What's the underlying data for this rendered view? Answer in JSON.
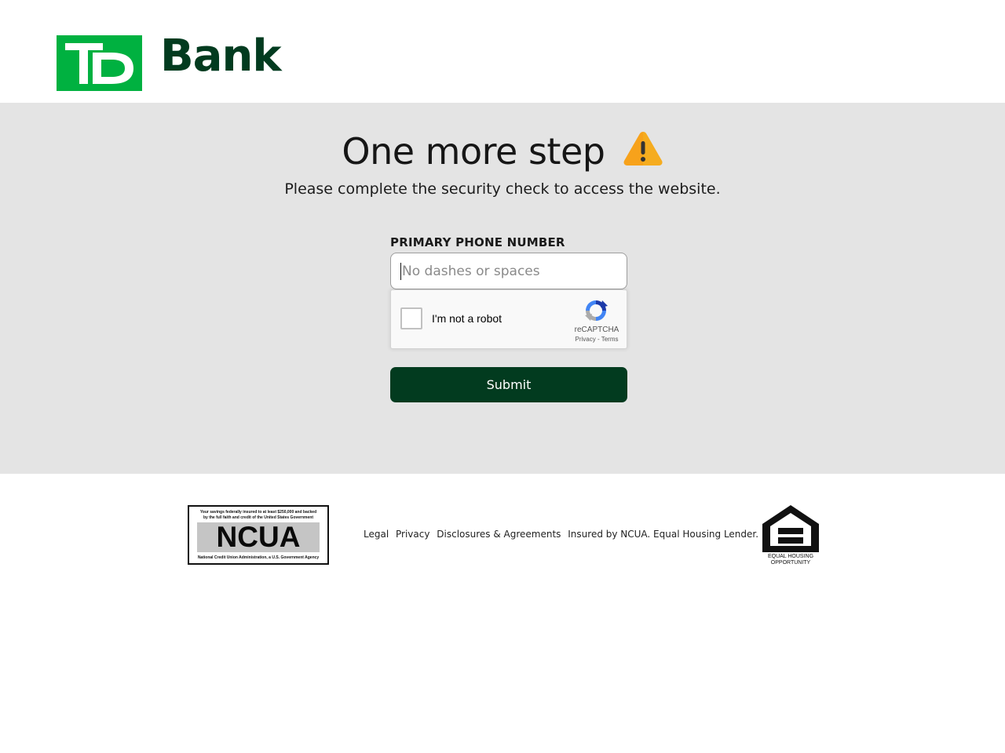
{
  "header": {
    "logo_mark": "TD",
    "logo_word": "Bank"
  },
  "main": {
    "headline": "One more step",
    "warning_icon": "warning-icon",
    "subline": "Please complete the security check to access the website.",
    "phone_label": "PRIMARY PHONE NUMBER",
    "phone_placeholder": "No dashes or spaces",
    "phone_value": "",
    "captcha": {
      "label": "I'm not a robot",
      "brand": "reCAPTCHA",
      "privacy": "Privacy",
      "separator": " - ",
      "terms": "Terms",
      "checked": false
    },
    "submit_label": "Submit"
  },
  "footer": {
    "ncua_badge": {
      "top_text": "Your savings federally insured to at least $250,000 and backed by the full faith and credit of the United States Government",
      "word": "NCUA",
      "bottom_text": "National Credit Union Administration, a U.S. Government Agency"
    },
    "links": {
      "legal": "Legal",
      "privacy": "Privacy",
      "disclosures": "Disclosures & Agreements"
    },
    "insured_text": "Insured by NCUA. Equal Housing Lender.",
    "ehl_badge": {
      "line1": "EQUAL HOUSING",
      "line2": "OPPORTUNITY"
    }
  },
  "colors": {
    "brand_green": "#00b140",
    "dark_green": "#023b1f",
    "page_band": "#e4e4e4",
    "warning_orange": "#f7a21b"
  }
}
